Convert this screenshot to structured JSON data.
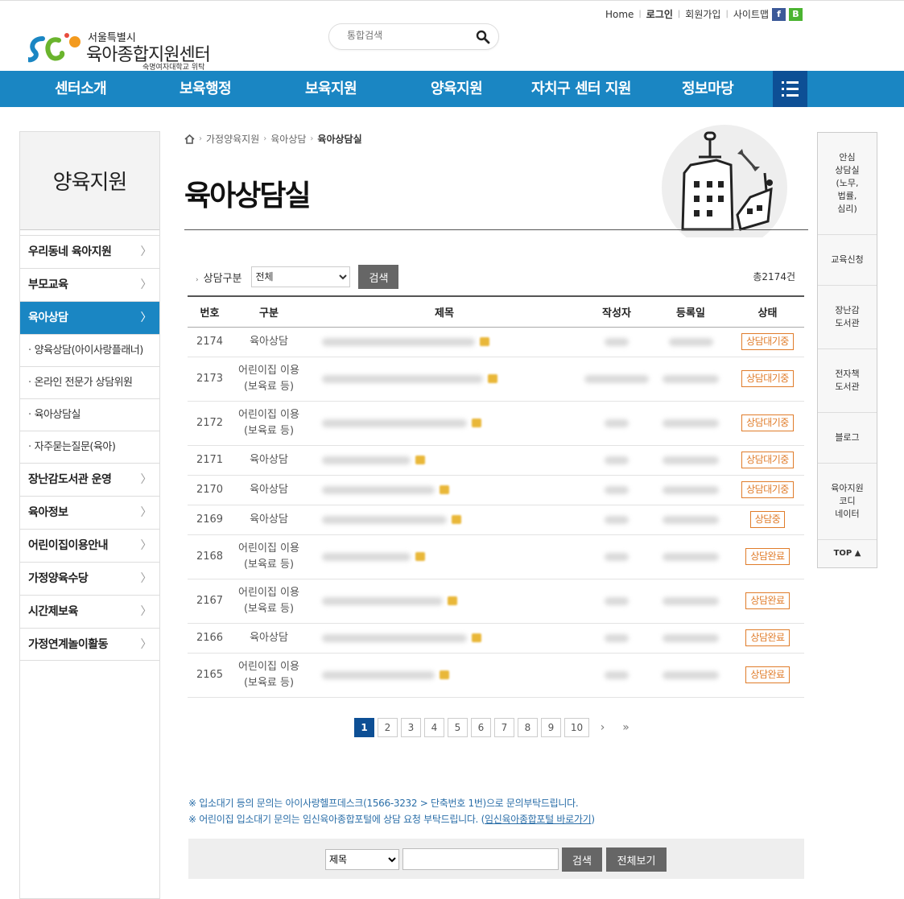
{
  "util": {
    "home": "Home",
    "login": "로그인",
    "join": "회원가입",
    "sitemap": "사이트맵",
    "facebook": "f",
    "blog": "B"
  },
  "logo": {
    "line1": "서울특별시",
    "line2": "육아종합지원센터",
    "line3": "숙명여자대학교 위탁"
  },
  "search": {
    "placeholder": "통합검색"
  },
  "nav": [
    "센터소개",
    "보육행정",
    "보육지원",
    "양육지원",
    "자치구 센터 지원",
    "정보마당"
  ],
  "sidebar": {
    "title": "양육지원",
    "menu1": [
      "우리동네 육아지원",
      "부모교육"
    ],
    "active": "육아상담",
    "sub": [
      "양육상담(아이사랑플래너)",
      "온라인 전문가 상담위원",
      "육아상담실",
      "자주묻는질문(육아)"
    ],
    "menu2": [
      "장난감도서관 운영",
      "육아정보",
      "어린이집이용안내",
      "가정양육수당",
      "시간제보육",
      "가정연계놀이활동"
    ]
  },
  "quick": {
    "items": [
      "안심\n상담실\n(노무,\n법률,\n심리)",
      "교육신청",
      "장난감\n도서관",
      "전자책\n도서관",
      "블로그",
      "육아지원\n코디\n네이터"
    ],
    "top": "TOP ▲"
  },
  "breadcrumb": [
    "가정양육지원",
    "육아상담",
    "육아상담실"
  ],
  "page_title": "육아상담실",
  "filter": {
    "label": "상담구분",
    "selected": "전체",
    "button": "검색"
  },
  "total": "총2174건",
  "table": {
    "headers": [
      "번호",
      "구분",
      "제목",
      "작성자",
      "등록일",
      "상태"
    ],
    "rows": [
      {
        "no": "2174",
        "cat": "육아상담",
        "status": "상담대기중"
      },
      {
        "no": "2173",
        "cat": "어린이집 이용\n(보육료 등)",
        "status": "상담대기중"
      },
      {
        "no": "2172",
        "cat": "어린이집 이용\n(보육료 등)",
        "status": "상담대기중"
      },
      {
        "no": "2171",
        "cat": "육아상담",
        "status": "상담대기중"
      },
      {
        "no": "2170",
        "cat": "육아상담",
        "status": "상담대기중"
      },
      {
        "no": "2169",
        "cat": "육아상담",
        "status": "상담중"
      },
      {
        "no": "2168",
        "cat": "어린이집 이용\n(보육료 등)",
        "status": "상담완료"
      },
      {
        "no": "2167",
        "cat": "어린이집 이용\n(보육료 등)",
        "status": "상담완료"
      },
      {
        "no": "2166",
        "cat": "육아상담",
        "status": "상담완료"
      },
      {
        "no": "2165",
        "cat": "어린이집 이용\n(보육료 등)",
        "status": "상담완료"
      }
    ]
  },
  "pager": {
    "pages": [
      "1",
      "2",
      "3",
      "4",
      "5",
      "6",
      "7",
      "8",
      "9",
      "10"
    ],
    "current": "1",
    "next": "›",
    "last": "»"
  },
  "notice": {
    "line1": "※ 입소대기 등의 문의는 아이사랑헬프데스크(1566-3232 > 단축번호 1번)으로 문의부탁드립니다.",
    "line2_pre": "※ 어린이집 입소대기 문의는 임신육아종합포털에 상담 요청 부탁드립니다. (",
    "line2_link": "임신육아종합포털 바로가기",
    "line2_post": ")"
  },
  "bottom_search": {
    "field": "제목",
    "search_btn": "검색",
    "all_btn": "전체보기"
  },
  "colors": {
    "nav": "#1a86c3",
    "nav_dark": "#0d4f95",
    "badge": "#e07c2a",
    "notice": "#2a6ea8"
  }
}
